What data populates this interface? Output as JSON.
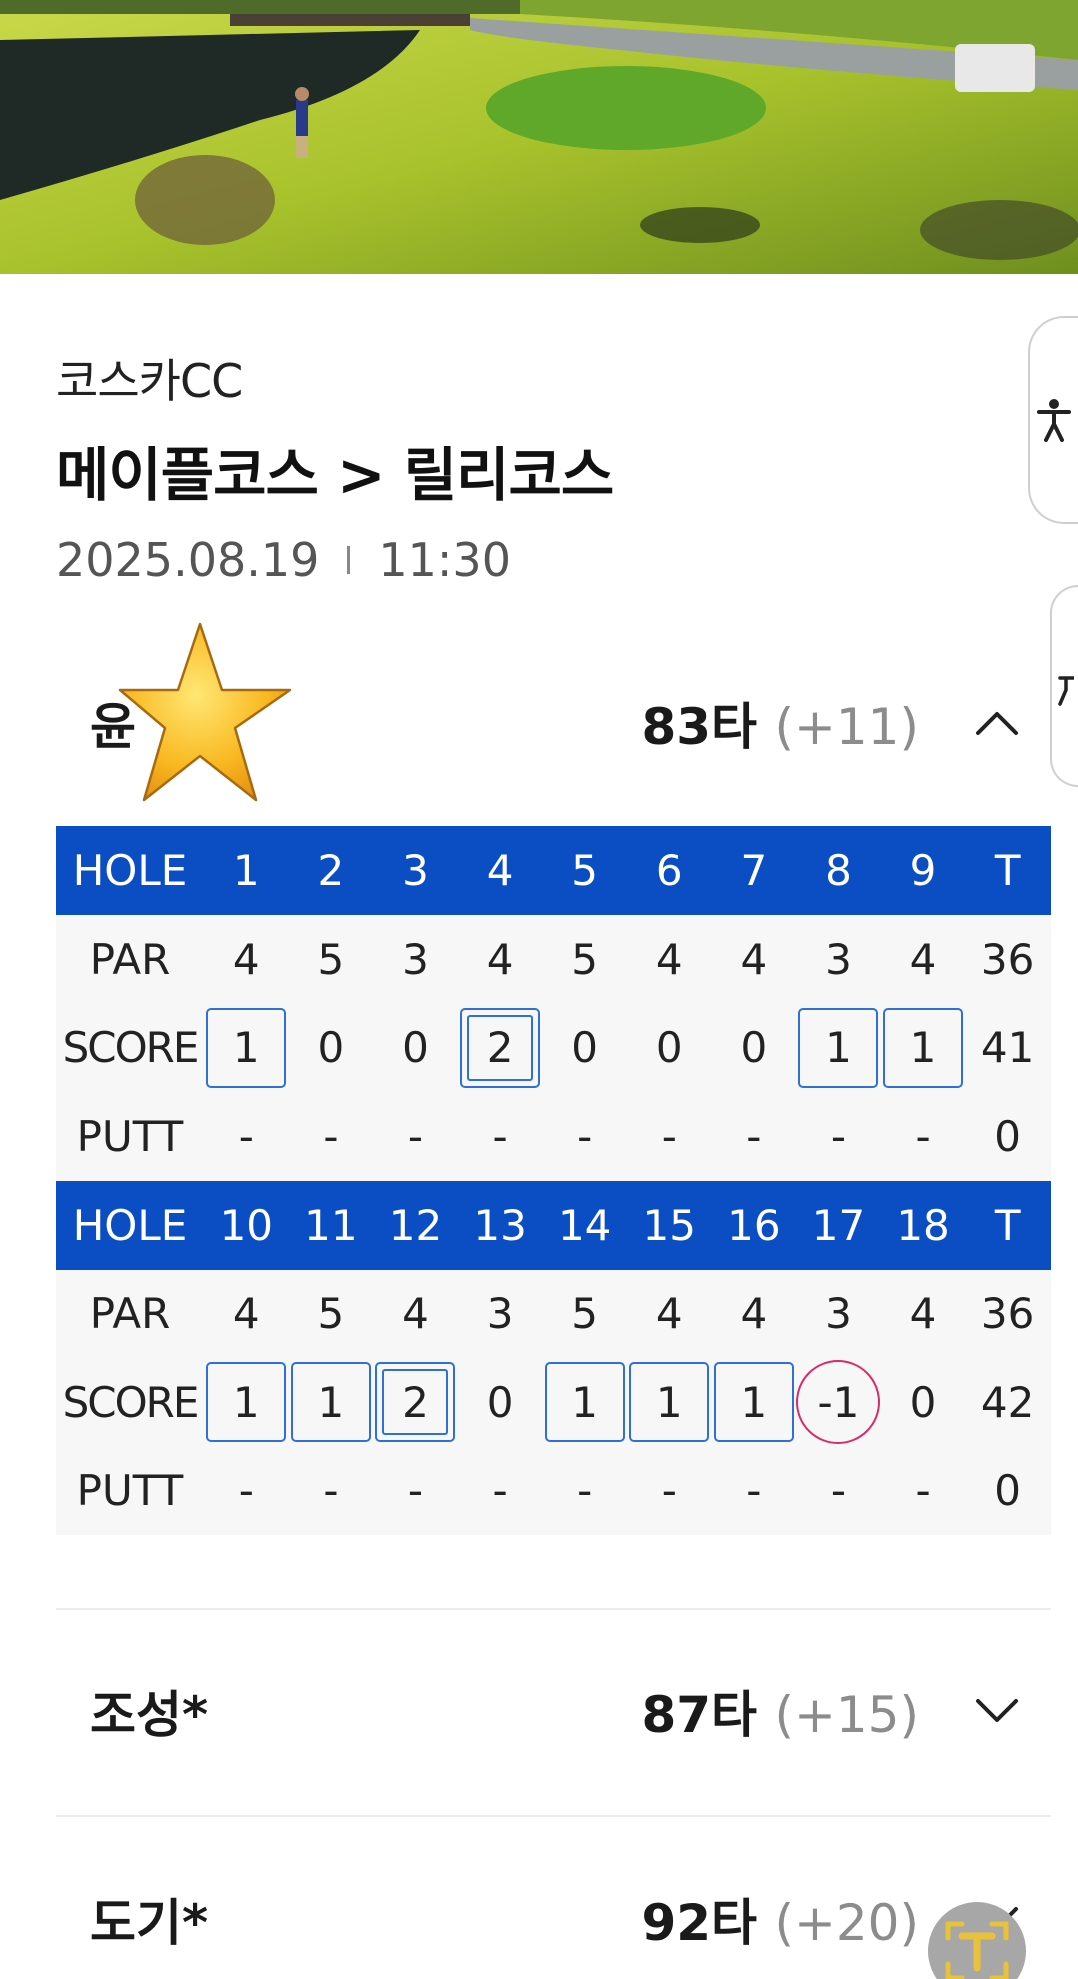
{
  "course_info": {
    "club": "코스카CC",
    "route": "메이플코스 > 릴리코스",
    "date": "2025.08.19",
    "time": "11:30"
  },
  "players": [
    {
      "name": "윤",
      "score": "83타",
      "diff": "(+11)",
      "expanded": true
    },
    {
      "name": "조성*",
      "score": "87타",
      "diff": "(+15)",
      "expanded": false
    },
    {
      "name": "도기*",
      "score": "92타",
      "diff": "(+20)",
      "expanded": false
    }
  ],
  "scorecard": {
    "labels": {
      "hole": "HOLE",
      "par": "PAR",
      "score": "SCORE",
      "putt": "PUTT"
    },
    "front": {
      "holes": [
        "1",
        "2",
        "3",
        "4",
        "5",
        "6",
        "7",
        "8",
        "9",
        "T"
      ],
      "par": [
        "4",
        "5",
        "3",
        "4",
        "5",
        "4",
        "4",
        "3",
        "4",
        "36"
      ],
      "score": [
        "1",
        "0",
        "0",
        "2",
        "0",
        "0",
        "0",
        "1",
        "1",
        "41"
      ],
      "score_marks": [
        "box",
        "",
        "",
        "double-box",
        "",
        "",
        "",
        "box",
        "box",
        ""
      ],
      "putt": [
        "-",
        "-",
        "-",
        "-",
        "-",
        "-",
        "-",
        "-",
        "-",
        "0"
      ]
    },
    "back": {
      "holes": [
        "10",
        "11",
        "12",
        "13",
        "14",
        "15",
        "16",
        "17",
        "18",
        "T"
      ],
      "par": [
        "4",
        "5",
        "4",
        "3",
        "5",
        "4",
        "4",
        "3",
        "4",
        "36"
      ],
      "score": [
        "1",
        "1",
        "2",
        "0",
        "1",
        "1",
        "1",
        "-1",
        "0",
        "42"
      ],
      "score_marks": [
        "box",
        "box",
        "double-box",
        "",
        "box",
        "box",
        "box",
        "circle",
        "",
        ""
      ],
      "putt": [
        "-",
        "-",
        "-",
        "-",
        "-",
        "-",
        "-",
        "-",
        "-",
        "0"
      ]
    }
  },
  "icons": {
    "side_tab": "accessibility-icon",
    "expand": "chevron-up-icon",
    "collapse": "chevron-down-icon",
    "badge": "star-icon",
    "fab": "translate-icon"
  },
  "colors": {
    "header_blue": "#0b4ec4",
    "bogey_box": "#2f6fd6",
    "birdie_circle": "#d62d6a",
    "diff_gray": "#8c8c8c"
  }
}
